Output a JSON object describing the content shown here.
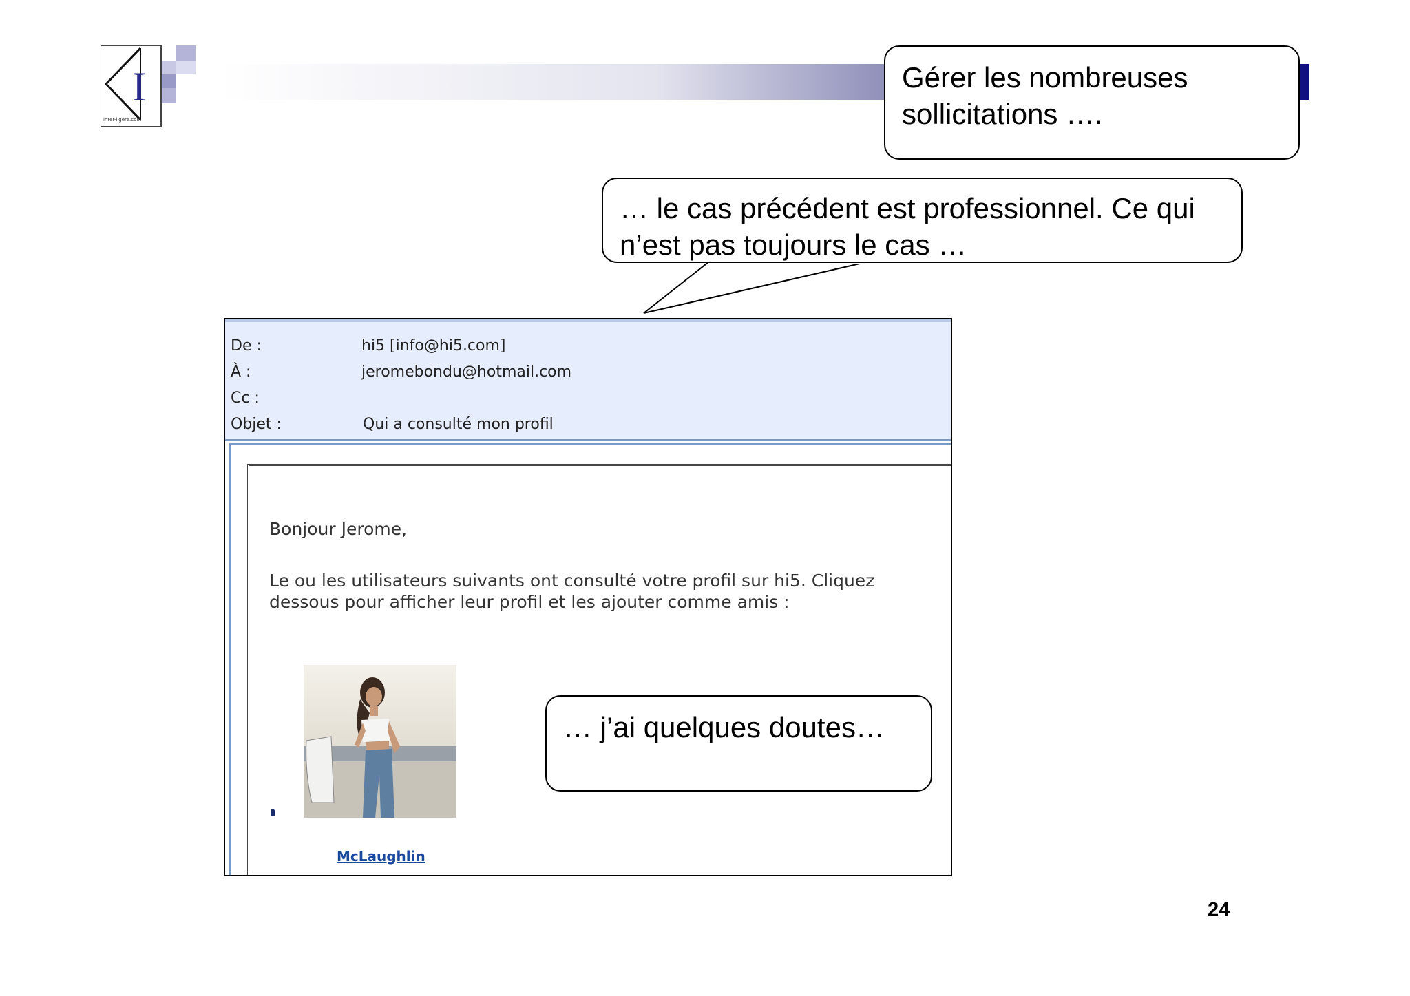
{
  "logo": {
    "caption": "inter-ligere.com",
    "letter": "I"
  },
  "colors": {
    "accent": "#0e0e7e",
    "header_bg": "#e6eefd",
    "link": "#1a4aa0"
  },
  "callouts": {
    "top_right": [
      "Gérer les nombreuses",
      "sollicitations …."
    ],
    "middle": [
      "… le cas précédent est professionnel. Ce qui",
      "n’est pas toujours le cas …"
    ],
    "photo": "… j’ai quelques doutes…"
  },
  "email": {
    "headers": [
      {
        "label": "De :",
        "value": "hi5 [info@hi5.com]"
      },
      {
        "label": "À :",
        "value": "jeromebondu@hotmail.com"
      },
      {
        "label": "Cc :",
        "value": ""
      },
      {
        "label": "Objet :",
        "value": "Qui a consulté mon profil"
      }
    ],
    "greeting": "Bonjour Jerome,",
    "paragraph": [
      "Le ou les utilisateurs suivants ont consulté votre profil sur hi5. Cliquez",
      "dessous pour afficher leur profil et les ajouter comme amis :"
    ],
    "profile_name": "McLaughlin"
  },
  "page_number": "24"
}
